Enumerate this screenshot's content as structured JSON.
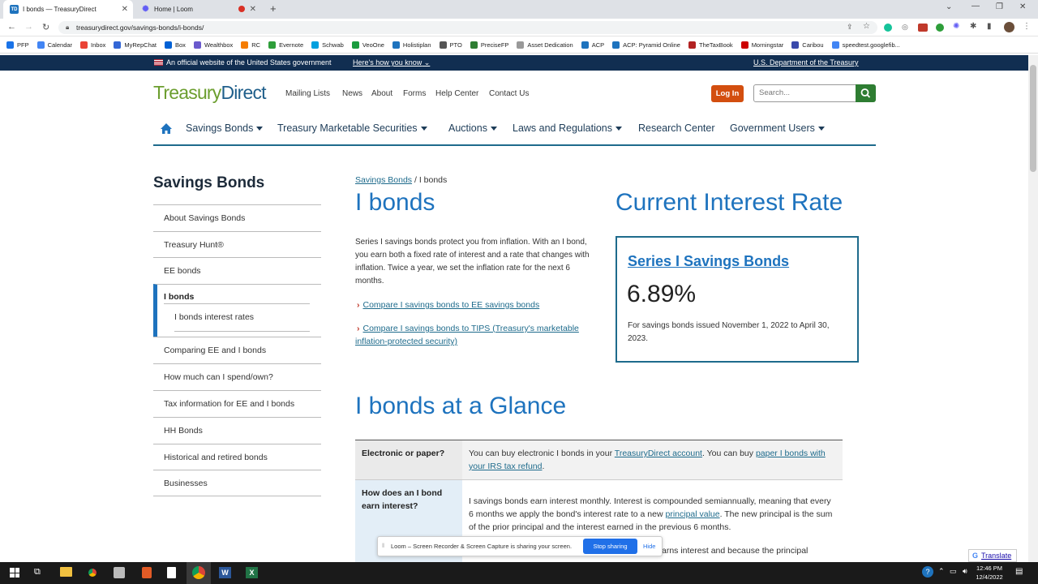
{
  "browser": {
    "tabs": [
      {
        "title": "I bonds — TreasuryDirect",
        "fav": "TD"
      },
      {
        "title": "Home | Loom",
        "fav": ""
      }
    ],
    "url": "treasurydirect.gov/savings-bonds/i-bonds/",
    "bookmarks": [
      "PFP",
      "Calendar",
      "Inbox",
      "MyRepChat",
      "Box",
      "Wealthbox",
      "RC",
      "Evernote",
      "Schwab",
      "VeoOne",
      "Holistiplan",
      "PTO",
      "PreciseFP",
      "Asset Dedication",
      "ACP",
      "ACP: Pyramid Online",
      "TheTaxBook",
      "Morningstar",
      "Caribou",
      "speedtest.googlefib..."
    ]
  },
  "gov_banner": {
    "official": "An official website of the United States government",
    "how": "Here's how you know",
    "dept": "U.S. Department of the Treasury"
  },
  "header": {
    "logo_a": "Treasury",
    "logo_b": "Direct",
    "links": [
      "Mailing Lists",
      "News",
      "About",
      "Forms",
      "Help Center",
      "Contact Us"
    ],
    "login": "Log In",
    "search_placeholder": "Search..."
  },
  "mainnav": [
    "Savings Bonds",
    "Treasury Marketable Securities",
    "Auctions",
    "Laws and Regulations",
    "Research Center",
    "Government Users"
  ],
  "sidebar": {
    "title": "Savings Bonds",
    "items": [
      "About Savings Bonds",
      "Treasury Hunt®",
      "EE bonds",
      "I bonds",
      "I bonds interest rates",
      "Comparing EE and I bonds",
      "How much can I spend/own?",
      "Tax information for EE and I bonds",
      "HH Bonds",
      "Historical and retired bonds",
      "Businesses"
    ]
  },
  "content": {
    "crumb_link": "Savings Bonds",
    "crumb_sep": " / ",
    "crumb_current": "I bonds",
    "title": "I bonds",
    "intro": "Series I savings bonds protect you from inflation. With an I bond, you earn both a fixed rate of interest and a rate that changes with inflation. Twice a year, we set the inflation rate for the next 6 months.",
    "compare_ee": "Compare I savings bonds to EE savings bonds",
    "compare_tips": "Compare I savings bonds to TIPS (Treasury's marketable inflation-protected security)",
    "rate_heading": "Current Interest Rate",
    "rate_link": "Series I Savings Bonds",
    "rate_value": "6.89%",
    "rate_note": "For savings bonds issued November 1, 2022 to April 30, 2023.",
    "glance": "I bonds at a Glance",
    "row1_h": "Electronic or paper?",
    "row1_a": "You can buy electronic I bonds in your ",
    "row1_l1": "TreasuryDirect account",
    "row1_b": ". You can buy ",
    "row1_l2": "paper I bonds with your IRS tax refund",
    "row1_c": ".",
    "row2_h": "How does an I bond earn interest?",
    "row2_a": "I savings bonds earn interest monthly. Interest is compounded semiannually, meaning that every 6 months we apply the bond's interest rate to a new ",
    "row2_l": "principal value",
    "row2_b": ". The new principal is the sum of the prior principal and the interest earned in the previous 6 months.",
    "row2_more": "arns interest and because the principal"
  },
  "loom": {
    "msg": "Loom – Screen Recorder & Screen Capture is sharing your screen.",
    "stop": "Stop sharing",
    "hide": "Hide"
  },
  "translate": "Translate",
  "clock": {
    "time": "12:46 PM",
    "date": "12/4/2022"
  }
}
